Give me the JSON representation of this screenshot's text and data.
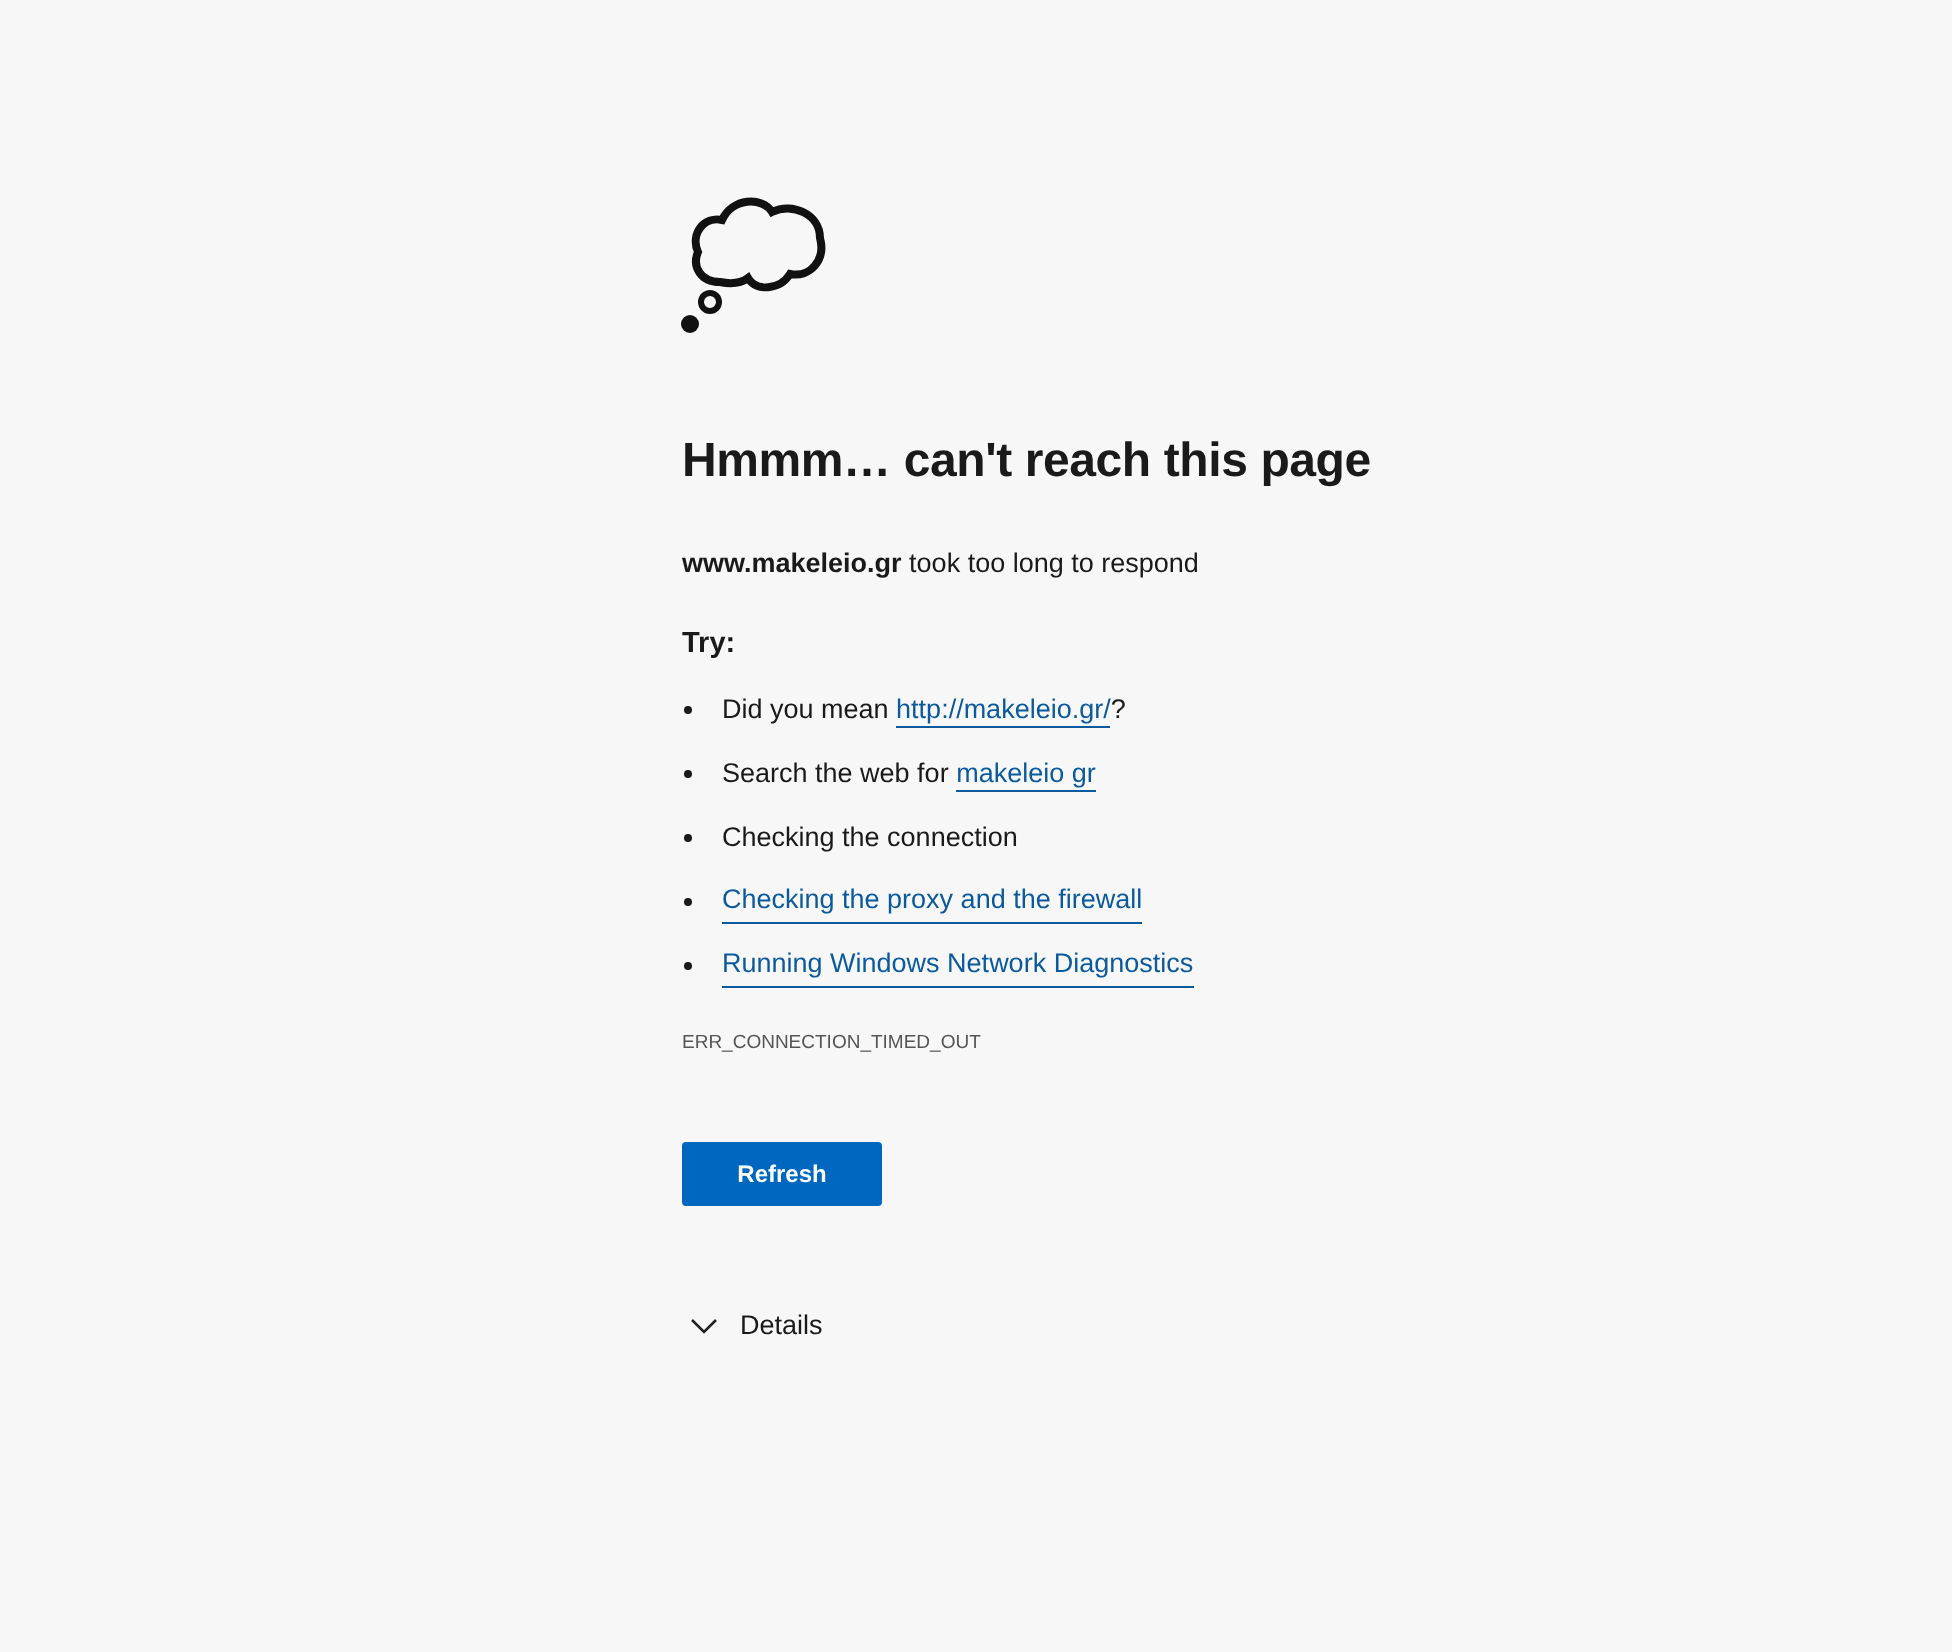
{
  "heading": "Hmmm… can't reach this page",
  "message": "**www.makeleio.gr** took too long to respond",
  "try_label": "Try:",
  "suggestions": [
    {
      "parts": [
        {
          "text": "Did you mean ",
          "link": false
        },
        {
          "text": "http://makeleio.gr/",
          "link": true
        },
        {
          "text": "?",
          "link": false
        }
      ]
    },
    {
      "parts": [
        {
          "text": "Search the web for ",
          "link": false
        },
        {
          "text": "makeleio gr",
          "link": true
        }
      ]
    },
    {
      "parts": [
        {
          "text": "Checking the connection",
          "link": false
        }
      ]
    },
    {
      "parts": [
        {
          "text": "Checking the proxy and the firewall",
          "link": true
        }
      ]
    },
    {
      "parts": [
        {
          "text": "Running Windows Network Diagnostics",
          "link": true
        }
      ]
    }
  ],
  "error_code": "ERR_CONNECTION_TIMED_OUT",
  "refresh_button": "Refresh",
  "details": {
    "label": "Details",
    "expanded": false
  }
}
